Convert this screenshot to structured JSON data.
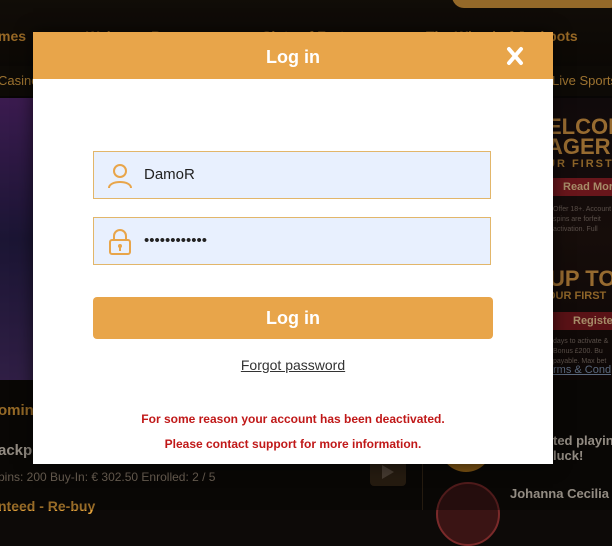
{
  "background": {
    "nav": [
      "mes",
      "Welcome Bonus",
      "Slots of Fortune",
      "The Wheel of Jackpots"
    ],
    "subnav": [
      "Casino",
      "Live Sports"
    ],
    "promo": {
      "headline_1": "ELCOME",
      "headline_2": "AGER",
      "sub_1": "UR FIRST",
      "read_more": "Read More",
      "fine_1": "Offer 18+. Account to",
      "fine_2": "spins are forfeit",
      "fine_3": "activation. Full",
      "headline_3": "UP TO",
      "sub_2": "OUR FIRST",
      "register": "Registe",
      "fine_4": "days to activate &",
      "fine_5": "Bonus £200. Bu",
      "fine_6": "payable. Max bet",
      "terms": "rms & Cond"
    },
    "lower": {
      "upcoming": "oming",
      "jackpot": "ackp",
      "stats": "pins: 200    Buy-In: € 302.50    Enrolled: 2 / 5",
      "guaranteed": "nteed - Re-buy",
      "winner_1": "ted playin",
      "winner_2": "luck!",
      "winner_name": "Johanna Cecilia",
      "s_char": "s"
    }
  },
  "modal": {
    "title": "Log in",
    "close_icon": "close-icon",
    "username": {
      "value": "DamoR",
      "icon": "user-icon"
    },
    "password": {
      "value": "••••••••••••",
      "icon": "lock-icon"
    },
    "login_button": "Log in",
    "forgot_password": "Forgot password",
    "error_line_1": "For some reason your account has been deactivated.",
    "error_line_2": "Please contact support for more information."
  },
  "colors": {
    "accent": "#e8a54a",
    "field_bg": "#e8f0fe",
    "error": "#c01818"
  }
}
